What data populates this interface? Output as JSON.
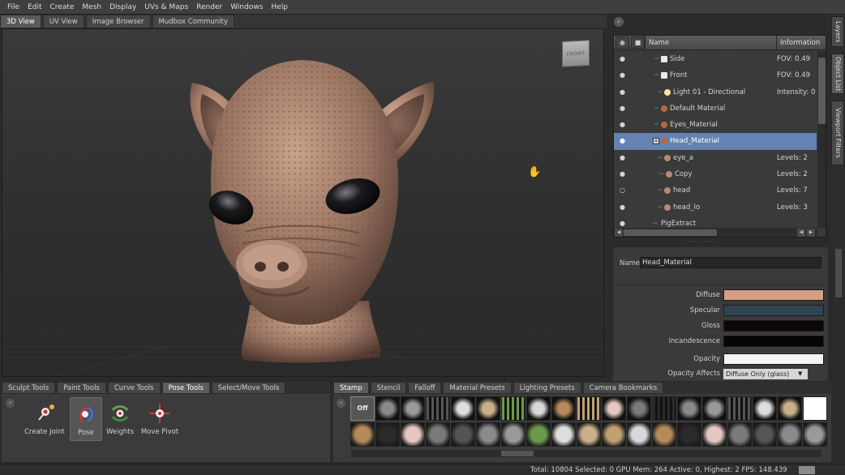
{
  "menu": [
    "File",
    "Edit",
    "Create",
    "Mesh",
    "Display",
    "UVs & Maps",
    "Render",
    "Windows",
    "Help"
  ],
  "view_tabs": [
    {
      "label": "3D View",
      "active": true
    },
    {
      "label": "UV View",
      "active": false
    },
    {
      "label": "Image Browser",
      "active": false
    },
    {
      "label": "Mudbox Community",
      "active": false
    }
  ],
  "viewport": {
    "viewcube_label": "FRONT"
  },
  "object_list": {
    "columns": {
      "name": "Name",
      "info": "Information"
    },
    "rows": [
      {
        "name": "Side",
        "info": "FOV: 0.49",
        "icon": "camera-icon",
        "visible": true,
        "selected": false,
        "indent": 58
      },
      {
        "name": "Front",
        "info": "FOV: 0.49",
        "icon": "camera-icon",
        "visible": true,
        "selected": false,
        "indent": 58
      },
      {
        "name": "Light 01 - Directional",
        "info": "Intensity: 0.",
        "icon": "light-icon",
        "visible": true,
        "selected": false,
        "indent": 62
      },
      {
        "name": "Default Material",
        "info": "",
        "icon": "material-icon",
        "visible": true,
        "selected": false,
        "indent": 58
      },
      {
        "name": "Eyes_Material",
        "info": "",
        "icon": "material-icon",
        "visible": true,
        "selected": false,
        "indent": 58
      },
      {
        "name": "Head_Material",
        "info": "",
        "icon": "material-icon",
        "visible": true,
        "selected": true,
        "indent": 58
      },
      {
        "name": "eye_a",
        "info": "Levels: 2",
        "icon": "mesh-icon",
        "visible": true,
        "selected": false,
        "indent": 62
      },
      {
        "name": "Copy",
        "info": "Levels: 2",
        "icon": "mesh-icon",
        "visible": true,
        "selected": false,
        "indent": 64
      },
      {
        "name": "head",
        "info": "Levels: 7",
        "icon": "mesh-icon",
        "visible": false,
        "selected": false,
        "indent": 62
      },
      {
        "name": "head_lo",
        "info": "Levels: 3",
        "icon": "mesh-icon",
        "visible": true,
        "selected": false,
        "indent": 62
      },
      {
        "name": "PigExtract",
        "info": "",
        "icon": "",
        "visible": true,
        "selected": false,
        "indent": 56
      }
    ]
  },
  "side_tabs": [
    "Layers",
    "Object List",
    "Viewport Filters"
  ],
  "properties": {
    "name_label": "Name",
    "name_value": "Head_Material",
    "fields": [
      {
        "label": "Diffuse",
        "color": "#d49f85"
      },
      {
        "label": "Specular",
        "color": "#2f4450"
      },
      {
        "label": "Gloss",
        "color": "#0c0607"
      },
      {
        "label": "Incandescence",
        "color": "#060506"
      },
      {
        "label": "Opacity",
        "color": "#f4f4f4"
      }
    ],
    "opacity_affects_label": "Opacity Affects",
    "opacity_affects_value": "Diffuse Only (glass)"
  },
  "tool_tabs": [
    {
      "label": "Sculpt Tools",
      "active": false
    },
    {
      "label": "Paint Tools",
      "active": false
    },
    {
      "label": "Curve Tools",
      "active": false
    },
    {
      "label": "Pose Tools",
      "active": true
    },
    {
      "label": "Select/Move Tools",
      "active": false
    }
  ],
  "pose_tools": [
    {
      "label": "Create Joint",
      "icon": "create-joint-icon",
      "active": false
    },
    {
      "label": "Pose",
      "icon": "pose-icon",
      "active": true
    },
    {
      "label": "Weights",
      "icon": "weights-icon",
      "active": false
    },
    {
      "label": "Move Pivot",
      "icon": "move-pivot-icon",
      "active": false
    }
  ],
  "stamp_tabs": [
    {
      "label": "Stamp",
      "active": true
    },
    {
      "label": "Stencil",
      "active": false
    },
    {
      "label": "Falloff",
      "active": false
    },
    {
      "label": "Material Presets",
      "active": false
    },
    {
      "label": "Lighting Presets",
      "active": false
    },
    {
      "label": "Camera Bookmarks",
      "active": false
    }
  ],
  "stamp_off_label": "Off",
  "status": "Total: 10804  Selected: 0 GPU Mem: 264  Active: 0, Highest: 2  FPS: 148.439"
}
